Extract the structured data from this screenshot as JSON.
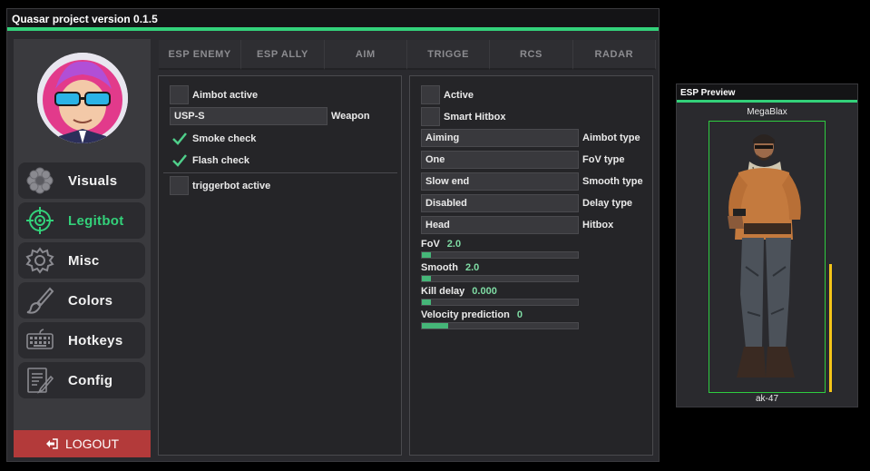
{
  "window": {
    "title": "Quasar project version 0.1.5",
    "accent_color": "#33d17a"
  },
  "sidebar": {
    "avatar_icon": "avatar-rick-sunglasses",
    "items": [
      {
        "label": "Visuals",
        "icon": "flower-icon",
        "active": false
      },
      {
        "label": "Legitbot",
        "icon": "crosshair-icon",
        "active": true
      },
      {
        "label": "Misc",
        "icon": "gear-icon",
        "active": false
      },
      {
        "label": "Colors",
        "icon": "brush-icon",
        "active": false
      },
      {
        "label": "Hotkeys",
        "icon": "keyboard-icon",
        "active": false
      },
      {
        "label": "Config",
        "icon": "document-edit-icon",
        "active": false
      }
    ],
    "logout_label": "LOGOUT",
    "logout_color": "#b33a3a"
  },
  "tabs": [
    "ESP ENEMY",
    "ESP ALLY",
    "AIM",
    "TRIGGE",
    "RCS",
    "RADAR"
  ],
  "left_panel": {
    "aimbot_active": {
      "label": "Aimbot active",
      "checked": false
    },
    "weapon": {
      "value": "USP-S",
      "label": "Weapon"
    },
    "smoke_check": {
      "label": "Smoke check",
      "checked": true
    },
    "flash_check": {
      "label": "Flash check",
      "checked": true
    },
    "triggerbot_active": {
      "label": "triggerbot active",
      "checked": false
    }
  },
  "right_panel": {
    "active": {
      "label": "Active",
      "checked": false
    },
    "smart_hitbox": {
      "label": "Smart Hitbox",
      "checked": false
    },
    "aimbot_type": {
      "value": "Aiming",
      "label": "Aimbot type"
    },
    "fov_type": {
      "value": "One",
      "label": "FoV type"
    },
    "smooth_type": {
      "value": "Slow end",
      "label": "Smooth type"
    },
    "delay_type": {
      "value": "Disabled",
      "label": "Delay type"
    },
    "hitbox": {
      "value": "Head",
      "label": "Hitbox"
    },
    "sliders": [
      {
        "label": "FoV",
        "value": "2.0",
        "fill": 0.06
      },
      {
        "label": "Smooth",
        "value": "2.0",
        "fill": 0.06
      },
      {
        "label": "Kill delay",
        "value": "0.000",
        "fill": 0.06
      },
      {
        "label": "Velocity prediction",
        "value": "0",
        "fill": 0.17
      }
    ]
  },
  "esp_preview": {
    "title": "ESP Preview",
    "player_name": "MegaBlax",
    "weapon": "ak-47",
    "box_color": "#2ecc40",
    "health_bar_color": "#f5c518",
    "model_icon": "soldier-model"
  }
}
